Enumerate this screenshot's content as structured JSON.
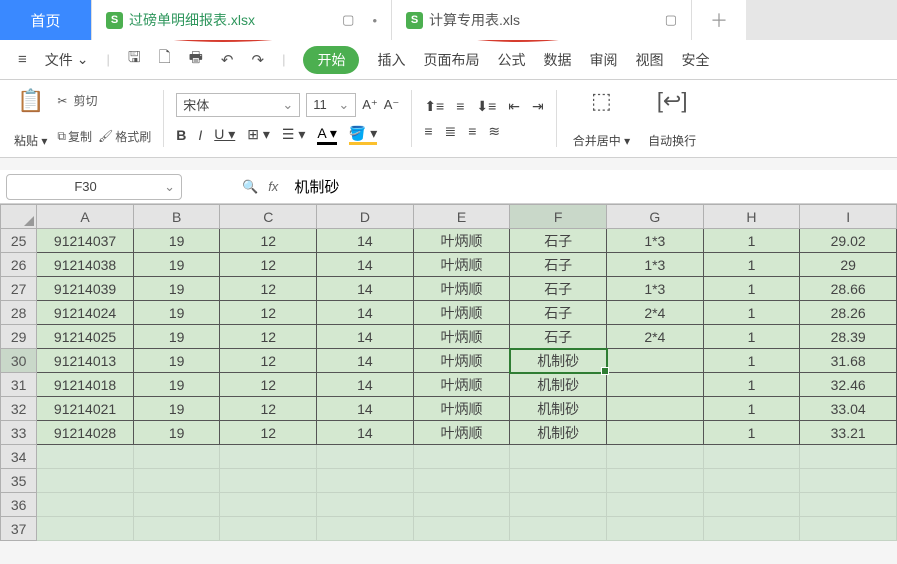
{
  "tabs": {
    "home": "首页",
    "file1": "过磅单明细报表.xlsx",
    "file2": "计算专用表.xls"
  },
  "menu": {
    "file": "文件",
    "items": [
      "开始",
      "插入",
      "页面布局",
      "公式",
      "数据",
      "审阅",
      "视图",
      "安全"
    ]
  },
  "ribbon": {
    "paste": "粘贴",
    "cut": "剪切",
    "copy": "复制",
    "format_painter": "格式刷",
    "font_name": "宋体",
    "font_size": "11",
    "merge_center": "合并居中",
    "wrap_text": "自动换行"
  },
  "formula": {
    "cell_ref": "F30",
    "value": "机制砂"
  },
  "grid": {
    "columns": [
      "A",
      "B",
      "C",
      "D",
      "E",
      "F",
      "G",
      "H",
      "I"
    ],
    "rows": [
      {
        "hdr": "25",
        "cells": [
          "91214037",
          "19",
          "12",
          "14",
          "叶炳顺",
          "石子",
          "1*3",
          "1",
          "29.02"
        ]
      },
      {
        "hdr": "26",
        "cells": [
          "91214038",
          "19",
          "12",
          "14",
          "叶炳顺",
          "石子",
          "1*3",
          "1",
          "29"
        ]
      },
      {
        "hdr": "27",
        "cells": [
          "91214039",
          "19",
          "12",
          "14",
          "叶炳顺",
          "石子",
          "1*3",
          "1",
          "28.66"
        ]
      },
      {
        "hdr": "28",
        "cells": [
          "91214024",
          "19",
          "12",
          "14",
          "叶炳顺",
          "石子",
          "2*4",
          "1",
          "28.26"
        ]
      },
      {
        "hdr": "29",
        "cells": [
          "91214025",
          "19",
          "12",
          "14",
          "叶炳顺",
          "石子",
          "2*4",
          "1",
          "28.39"
        ]
      },
      {
        "hdr": "30",
        "cells": [
          "91214013",
          "19",
          "12",
          "14",
          "叶炳顺",
          "机制砂",
          "",
          "1",
          "31.68"
        ]
      },
      {
        "hdr": "31",
        "cells": [
          "91214018",
          "19",
          "12",
          "14",
          "叶炳顺",
          "机制砂",
          "",
          "1",
          "32.46"
        ]
      },
      {
        "hdr": "32",
        "cells": [
          "91214021",
          "19",
          "12",
          "14",
          "叶炳顺",
          "机制砂",
          "",
          "1",
          "33.04"
        ]
      },
      {
        "hdr": "33",
        "cells": [
          "91214028",
          "19",
          "12",
          "14",
          "叶炳顺",
          "机制砂",
          "",
          "1",
          "33.21"
        ]
      }
    ],
    "empty_rows": [
      "34",
      "35",
      "36",
      "37"
    ]
  }
}
